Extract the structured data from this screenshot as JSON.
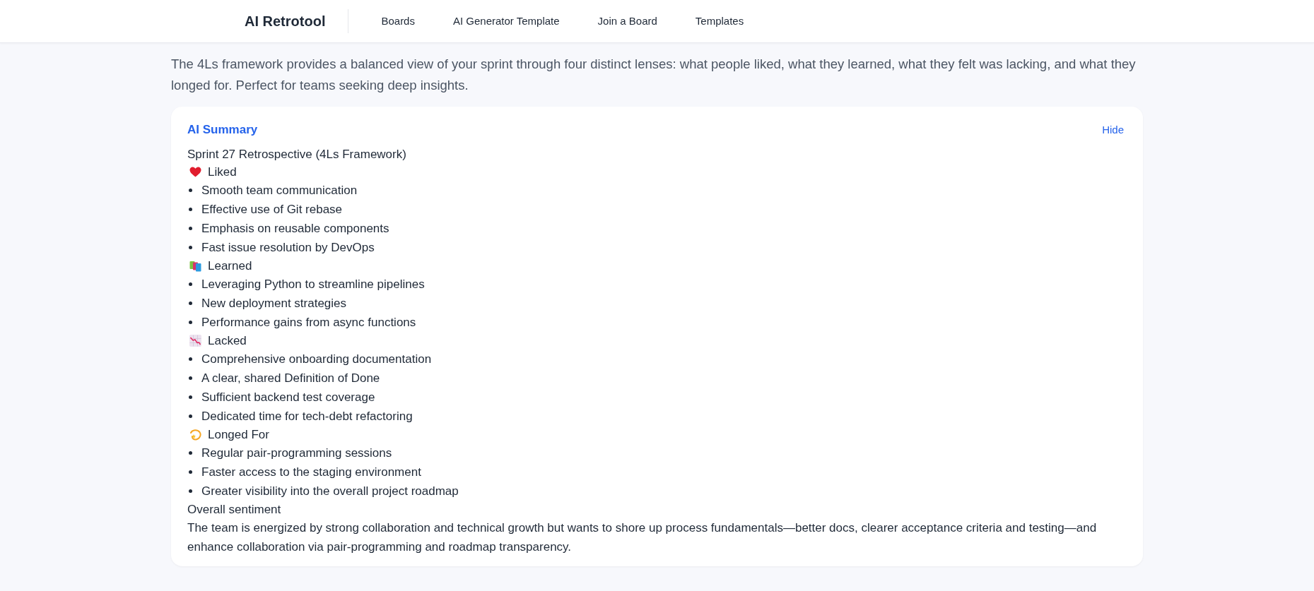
{
  "header": {
    "logo": "AI Retrotool",
    "nav": [
      "Boards",
      "AI Generator Template",
      "Join a Board",
      "Templates"
    ]
  },
  "description": "The 4Ls framework provides a balanced view of your sprint through four distinct lenses: what people liked, what they learned, what they felt was lacking, and what they longed for. Perfect for teams seeking deep insights.",
  "summary": {
    "title": "AI Summary",
    "hide_button": "Hide",
    "heading": "Sprint 27 Retrospective (4Ls Framework)",
    "sections": [
      {
        "kind": "liked",
        "title": "Liked",
        "items": [
          "Smooth team communication",
          "Effective use of Git rebase",
          "Emphasis on reusable components",
          "Fast issue resolution by DevOps"
        ]
      },
      {
        "kind": "learned",
        "title": "Learned",
        "items": [
          "Leveraging Python to streamline pipelines",
          "New deployment strategies",
          "Performance gains from async functions"
        ]
      },
      {
        "kind": "lacked",
        "title": "Lacked",
        "items": [
          "Comprehensive onboarding documentation",
          "A clear, shared Definition of Done",
          "Sufficient backend test coverage",
          "Dedicated time for tech-debt refactoring"
        ]
      },
      {
        "kind": "longed",
        "title": "Longed For",
        "items": [
          "Regular pair-programming sessions",
          "Faster access to the staging environment",
          "Greater visibility into the overall project roadmap"
        ]
      }
    ],
    "sentiment": {
      "title": "Overall sentiment",
      "text": "The team is energized by strong collaboration and technical growth but wants to shore up process fundamentals—better docs, clearer acceptance criteria and testing—and enhance collaboration via pair-programming and roadmap transparency."
    }
  }
}
